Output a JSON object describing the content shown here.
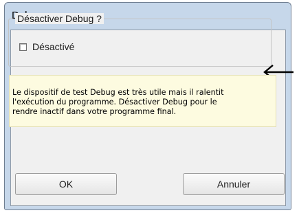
{
  "window": {
    "title": "Debug"
  },
  "group": {
    "legend": "Désactiver Debug ?"
  },
  "checkbox": {
    "label": "Désactivé",
    "checked": false
  },
  "annotation": {
    "icon": "left-arrow-icon"
  },
  "info": {
    "lines": [
      "Le dispositif de test Debug est très utile mais il ralentit",
      "l'exécution du programme. Désactiver Debug pour le",
      "rendre inactif dans votre programme final."
    ]
  },
  "buttons": {
    "ok_label": "OK",
    "cancel_label": "Annuler"
  }
}
